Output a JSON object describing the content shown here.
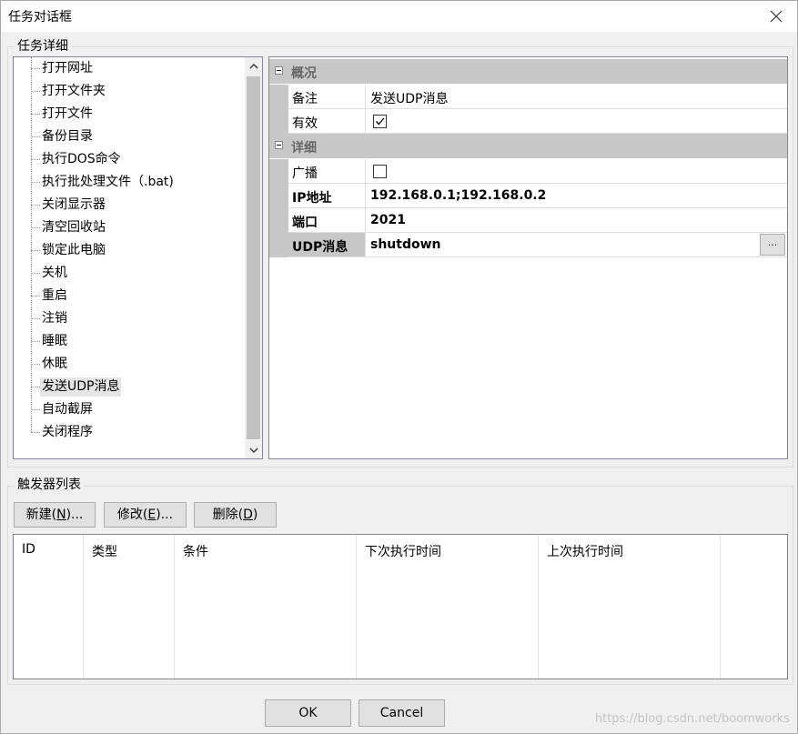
{
  "window": {
    "title": "任务对话框"
  },
  "task_details": {
    "legend": "任务详细",
    "tree_items": [
      {
        "label": "打开网址"
      },
      {
        "label": "打开文件夹"
      },
      {
        "label": "打开文件"
      },
      {
        "label": "备份目录"
      },
      {
        "label": "执行DOS命令"
      },
      {
        "label": "执行批处理文件（.bat)"
      },
      {
        "label": "关闭显示器"
      },
      {
        "label": "清空回收站"
      },
      {
        "label": "锁定此电脑"
      },
      {
        "label": "关机"
      },
      {
        "label": "重启"
      },
      {
        "label": "注销"
      },
      {
        "label": "睡眠"
      },
      {
        "label": "休眠"
      },
      {
        "label": "发送UDP消息",
        "selected": true
      },
      {
        "label": "自动截屏"
      },
      {
        "label": "关闭程序"
      }
    ],
    "property_grid": {
      "categories": [
        {
          "name": "概况",
          "props": [
            {
              "name": "备注",
              "value": "发送UDP消息",
              "type": "text",
              "bold": false
            },
            {
              "name": "有效",
              "value": "",
              "type": "checkbox",
              "checked": true,
              "bold": false
            }
          ]
        },
        {
          "name": "详细",
          "props": [
            {
              "name": "广播",
              "value": "",
              "type": "checkbox",
              "checked": false,
              "bold": false
            },
            {
              "name": "IP地址",
              "value": "192.168.0.1;192.168.0.2",
              "type": "text",
              "bold": true
            },
            {
              "name": "端口",
              "value": "2021",
              "type": "text",
              "bold": true
            },
            {
              "name": "UDP消息",
              "value": "shutdown",
              "type": "text-ellipsis",
              "bold": true,
              "selected": true,
              "button_label": "..."
            }
          ]
        }
      ]
    }
  },
  "triggers": {
    "legend": "触发器列表",
    "buttons": {
      "new": {
        "pre": "新建(",
        "key": "N",
        "post": ")..."
      },
      "edit": {
        "pre": "修改(",
        "key": "E",
        "post": ")..."
      },
      "delete": {
        "pre": "删除(",
        "key": "D",
        "post": ")"
      }
    },
    "columns": [
      "ID",
      "类型",
      "条件",
      "下次执行时间",
      "上次执行时间"
    ]
  },
  "footer": {
    "ok_label": "OK",
    "cancel_label": "Cancel",
    "watermark": "https://blog.csdn.net/boomworks"
  }
}
